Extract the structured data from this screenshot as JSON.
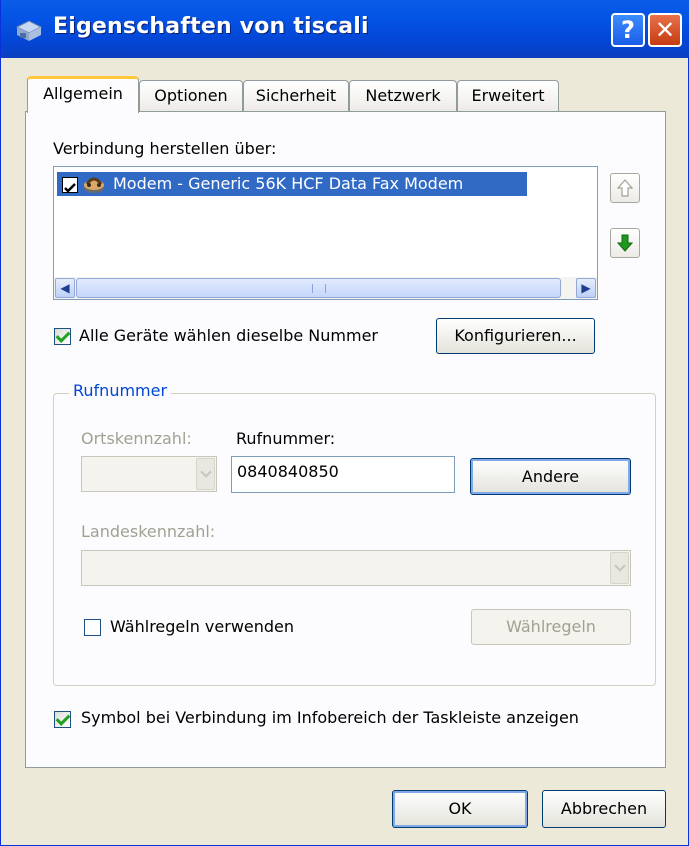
{
  "window": {
    "title": "Eigenschaften von tiscali",
    "help_label": "?",
    "close_label": "✕",
    "icon": "connection-icon"
  },
  "tabs": [
    {
      "label": "Allgemein",
      "active": true
    },
    {
      "label": "Optionen",
      "active": false
    },
    {
      "label": "Sicherheit",
      "active": false
    },
    {
      "label": "Netzwerk",
      "active": false
    },
    {
      "label": "Erweitert",
      "active": false
    }
  ],
  "general": {
    "connect_using_label": "Verbindung herstellen über:",
    "devices": [
      {
        "label": "Modem - Generic 56K HCF Data Fax Modem",
        "checked": true,
        "selected": true,
        "icon": "modem-icon"
      }
    ],
    "move_up_icon": "arrow-up-icon",
    "move_down_icon": "arrow-down-icon",
    "same_number": {
      "label": "Alle Geräte wählen dieselbe Nummer",
      "checked": true
    },
    "configure_button": "Konfigurieren..."
  },
  "phone_group": {
    "title": "Rufnummer",
    "area_code_label": "Ortskennzahl:",
    "area_code_value": "",
    "phone_number_label": "Rufnummer:",
    "phone_number_value": "0840840850",
    "alternates_button": "Andere",
    "country_code_label": "Landeskennzahl:",
    "country_code_value": "",
    "use_dialing_rules": {
      "label": "Wählregeln verwenden",
      "checked": false
    },
    "dialing_rules_button": "Wählregeln"
  },
  "show_icon": {
    "label": "Symbol bei Verbindung im Infobereich der Taskleiste anzeigen",
    "checked": true
  },
  "footer": {
    "ok_button": "OK",
    "cancel_button": "Abbrechen"
  },
  "colors": {
    "titlebar": "#0454e5",
    "selection": "#316ac5",
    "group_title": "#0046d5",
    "window_bg": "#ece9d8"
  }
}
